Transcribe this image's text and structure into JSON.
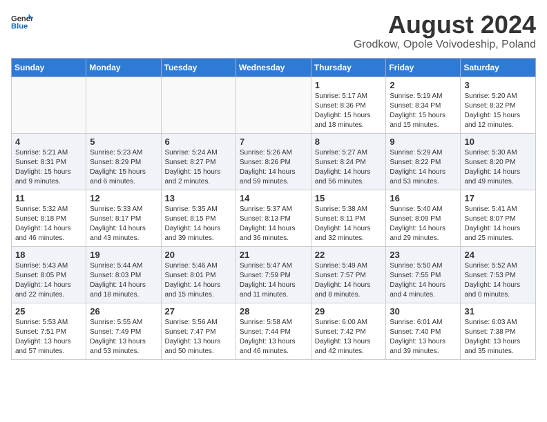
{
  "header": {
    "logo_general": "General",
    "logo_blue": "Blue",
    "month": "August 2024",
    "location": "Grodkow, Opole Voivodeship, Poland"
  },
  "weekdays": [
    "Sunday",
    "Monday",
    "Tuesday",
    "Wednesday",
    "Thursday",
    "Friday",
    "Saturday"
  ],
  "weeks": [
    [
      {
        "day": "",
        "info": ""
      },
      {
        "day": "",
        "info": ""
      },
      {
        "day": "",
        "info": ""
      },
      {
        "day": "",
        "info": ""
      },
      {
        "day": "1",
        "info": "Sunrise: 5:17 AM\nSunset: 8:36 PM\nDaylight: 15 hours\nand 18 minutes."
      },
      {
        "day": "2",
        "info": "Sunrise: 5:19 AM\nSunset: 8:34 PM\nDaylight: 15 hours\nand 15 minutes."
      },
      {
        "day": "3",
        "info": "Sunrise: 5:20 AM\nSunset: 8:32 PM\nDaylight: 15 hours\nand 12 minutes."
      }
    ],
    [
      {
        "day": "4",
        "info": "Sunrise: 5:21 AM\nSunset: 8:31 PM\nDaylight: 15 hours\nand 9 minutes."
      },
      {
        "day": "5",
        "info": "Sunrise: 5:23 AM\nSunset: 8:29 PM\nDaylight: 15 hours\nand 6 minutes."
      },
      {
        "day": "6",
        "info": "Sunrise: 5:24 AM\nSunset: 8:27 PM\nDaylight: 15 hours\nand 2 minutes."
      },
      {
        "day": "7",
        "info": "Sunrise: 5:26 AM\nSunset: 8:26 PM\nDaylight: 14 hours\nand 59 minutes."
      },
      {
        "day": "8",
        "info": "Sunrise: 5:27 AM\nSunset: 8:24 PM\nDaylight: 14 hours\nand 56 minutes."
      },
      {
        "day": "9",
        "info": "Sunrise: 5:29 AM\nSunset: 8:22 PM\nDaylight: 14 hours\nand 53 minutes."
      },
      {
        "day": "10",
        "info": "Sunrise: 5:30 AM\nSunset: 8:20 PM\nDaylight: 14 hours\nand 49 minutes."
      }
    ],
    [
      {
        "day": "11",
        "info": "Sunrise: 5:32 AM\nSunset: 8:18 PM\nDaylight: 14 hours\nand 46 minutes."
      },
      {
        "day": "12",
        "info": "Sunrise: 5:33 AM\nSunset: 8:17 PM\nDaylight: 14 hours\nand 43 minutes."
      },
      {
        "day": "13",
        "info": "Sunrise: 5:35 AM\nSunset: 8:15 PM\nDaylight: 14 hours\nand 39 minutes."
      },
      {
        "day": "14",
        "info": "Sunrise: 5:37 AM\nSunset: 8:13 PM\nDaylight: 14 hours\nand 36 minutes."
      },
      {
        "day": "15",
        "info": "Sunrise: 5:38 AM\nSunset: 8:11 PM\nDaylight: 14 hours\nand 32 minutes."
      },
      {
        "day": "16",
        "info": "Sunrise: 5:40 AM\nSunset: 8:09 PM\nDaylight: 14 hours\nand 29 minutes."
      },
      {
        "day": "17",
        "info": "Sunrise: 5:41 AM\nSunset: 8:07 PM\nDaylight: 14 hours\nand 25 minutes."
      }
    ],
    [
      {
        "day": "18",
        "info": "Sunrise: 5:43 AM\nSunset: 8:05 PM\nDaylight: 14 hours\nand 22 minutes."
      },
      {
        "day": "19",
        "info": "Sunrise: 5:44 AM\nSunset: 8:03 PM\nDaylight: 14 hours\nand 18 minutes."
      },
      {
        "day": "20",
        "info": "Sunrise: 5:46 AM\nSunset: 8:01 PM\nDaylight: 14 hours\nand 15 minutes."
      },
      {
        "day": "21",
        "info": "Sunrise: 5:47 AM\nSunset: 7:59 PM\nDaylight: 14 hours\nand 11 minutes."
      },
      {
        "day": "22",
        "info": "Sunrise: 5:49 AM\nSunset: 7:57 PM\nDaylight: 14 hours\nand 8 minutes."
      },
      {
        "day": "23",
        "info": "Sunrise: 5:50 AM\nSunset: 7:55 PM\nDaylight: 14 hours\nand 4 minutes."
      },
      {
        "day": "24",
        "info": "Sunrise: 5:52 AM\nSunset: 7:53 PM\nDaylight: 14 hours\nand 0 minutes."
      }
    ],
    [
      {
        "day": "25",
        "info": "Sunrise: 5:53 AM\nSunset: 7:51 PM\nDaylight: 13 hours\nand 57 minutes."
      },
      {
        "day": "26",
        "info": "Sunrise: 5:55 AM\nSunset: 7:49 PM\nDaylight: 13 hours\nand 53 minutes."
      },
      {
        "day": "27",
        "info": "Sunrise: 5:56 AM\nSunset: 7:47 PM\nDaylight: 13 hours\nand 50 minutes."
      },
      {
        "day": "28",
        "info": "Sunrise: 5:58 AM\nSunset: 7:44 PM\nDaylight: 13 hours\nand 46 minutes."
      },
      {
        "day": "29",
        "info": "Sunrise: 6:00 AM\nSunset: 7:42 PM\nDaylight: 13 hours\nand 42 minutes."
      },
      {
        "day": "30",
        "info": "Sunrise: 6:01 AM\nSunset: 7:40 PM\nDaylight: 13 hours\nand 39 minutes."
      },
      {
        "day": "31",
        "info": "Sunrise: 6:03 AM\nSunset: 7:38 PM\nDaylight: 13 hours\nand 35 minutes."
      }
    ]
  ]
}
